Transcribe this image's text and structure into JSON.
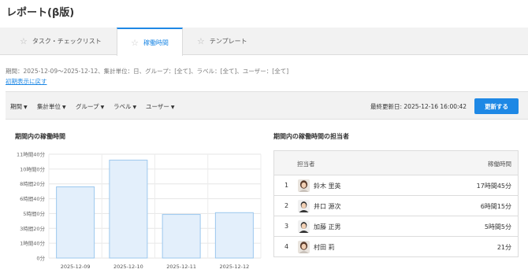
{
  "page": {
    "title": "レポート(β版)"
  },
  "tabs": [
    {
      "label": "タスク・チェックリスト",
      "active": false
    },
    {
      "label": "稼働時間",
      "active": true
    },
    {
      "label": "テンプレート",
      "active": false
    }
  ],
  "filter": {
    "summary": "期間：2025-12-09〜2025-12-12、集計単位：日、グループ：[全て]、ラベル：[全て]、ユーザー：[全て]",
    "reset_link": "初期表示に戻す"
  },
  "toolbar": {
    "dropdowns": [
      "期間",
      "集計単位",
      "グループ",
      "ラベル",
      "ユーザー"
    ],
    "last_updated": "最終更新日: 2025-12-16 16:00:42",
    "update_button": "更新する"
  },
  "chart_section": {
    "title": "期間内の稼働時間"
  },
  "chart_data": {
    "type": "bar",
    "title": "期間内の稼働時間",
    "categories": [
      "2025-12-09",
      "2025-12-10",
      "2025-12-11",
      "2025-12-12"
    ],
    "values": [
      8.0,
      11.0,
      4.9,
      5.1
    ],
    "value_unit": "hours",
    "ylim": [
      0,
      11.667
    ],
    "y_ticks": [
      {
        "value": 0,
        "label": "0分"
      },
      {
        "value": 1.6667,
        "label": "1時間40分"
      },
      {
        "value": 3.3333,
        "label": "3時間20分"
      },
      {
        "value": 5.0,
        "label": "5時間0分"
      },
      {
        "value": 6.6667,
        "label": "6時間40分"
      },
      {
        "value": 8.3333,
        "label": "8時間20分"
      },
      {
        "value": 10.0,
        "label": "10時間0分"
      },
      {
        "value": 11.6667,
        "label": "11時間40分"
      }
    ],
    "grid": true,
    "bar_color": "#e3effb",
    "bar_border": "#9cc8ee"
  },
  "assignees": {
    "title": "期間内の稼働時間の担当者",
    "columns": [
      "担当者",
      "稼働時間"
    ],
    "rows": [
      {
        "rank": "1",
        "name": "鈴木 里英",
        "hours": "17時間45分",
        "avatar": "woman-avatar"
      },
      {
        "rank": "2",
        "name": "井口 源次",
        "hours": "6時間15分",
        "avatar": "man-avatar"
      },
      {
        "rank": "3",
        "name": "加藤 正男",
        "hours": "5時間5分",
        "avatar": "man-avatar"
      },
      {
        "rank": "4",
        "name": "村田 莉",
        "hours": "21分",
        "avatar": "woman-avatar"
      }
    ]
  },
  "colors": {
    "accent": "#1e88e5",
    "toolbar_bg": "#f2f2f2"
  }
}
